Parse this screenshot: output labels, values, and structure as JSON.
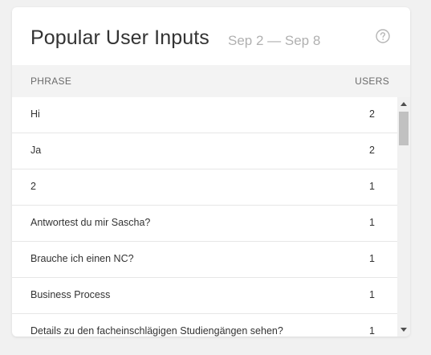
{
  "widget": {
    "title": "Popular User Inputs",
    "date_range": "Sep 2 — Sep 8",
    "help_icon": "question-circle-icon"
  },
  "table": {
    "columns": {
      "phrase": "PHRASE",
      "users": "USERS"
    },
    "rows": [
      {
        "phrase": "Hi",
        "users": "2"
      },
      {
        "phrase": "Ja",
        "users": "2"
      },
      {
        "phrase": "2",
        "users": "1"
      },
      {
        "phrase": "Antwortest du mir Sascha?",
        "users": "1"
      },
      {
        "phrase": "Brauche ich einen NC?",
        "users": "1"
      },
      {
        "phrase": "Business Process",
        "users": "1"
      },
      {
        "phrase": "Details zu den facheinschlägigen Studiengängen sehen?",
        "users": "1"
      }
    ]
  },
  "colors": {
    "background": "#f1f1f1",
    "card": "#ffffff",
    "header_row": "#f3f3f3",
    "title_text": "#333333",
    "muted_text": "#b0b0b0"
  }
}
